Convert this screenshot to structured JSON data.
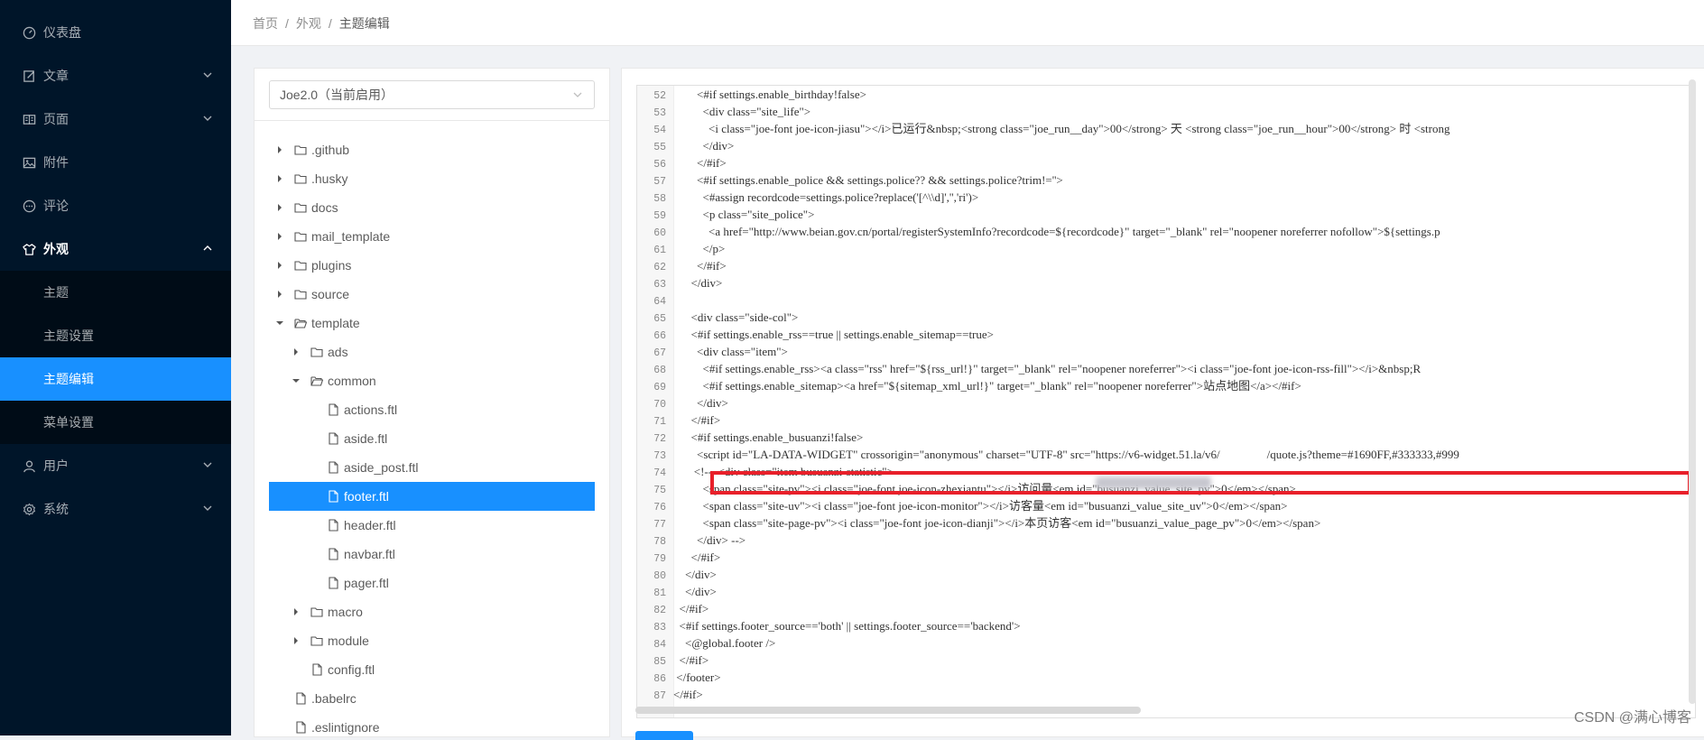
{
  "sidebar": {
    "items": [
      {
        "label": "仪表盘",
        "icon": "dashboard-icon"
      },
      {
        "label": "文章",
        "icon": "form-icon"
      },
      {
        "label": "页面",
        "icon": "read-icon"
      },
      {
        "label": "附件",
        "icon": "picture-icon"
      },
      {
        "label": "评论",
        "icon": "message-icon"
      },
      {
        "label": "外观",
        "icon": "skin-icon"
      },
      {
        "label": "用户",
        "icon": "user-icon"
      },
      {
        "label": "系统",
        "icon": "setting-icon"
      }
    ],
    "appearance_sub": [
      "主题",
      "主题设置",
      "主题编辑",
      "菜单设置"
    ]
  },
  "breadcrumb": [
    "首页",
    "外观",
    "主题编辑"
  ],
  "theme_select": {
    "value": "Joe2.0（当前启用）"
  },
  "file_tree": [
    {
      "name": ".github",
      "type": "folder"
    },
    {
      "name": ".husky",
      "type": "folder"
    },
    {
      "name": "docs",
      "type": "folder"
    },
    {
      "name": "mail_template",
      "type": "folder"
    },
    {
      "name": "plugins",
      "type": "folder"
    },
    {
      "name": "source",
      "type": "folder"
    },
    {
      "name": "template",
      "type": "folder-open"
    },
    {
      "name": "ads",
      "type": "folder"
    },
    {
      "name": "common",
      "type": "folder-open"
    },
    {
      "name": "actions.ftl",
      "type": "file"
    },
    {
      "name": "aside.ftl",
      "type": "file"
    },
    {
      "name": "aside_post.ftl",
      "type": "file"
    },
    {
      "name": "footer.ftl",
      "type": "file"
    },
    {
      "name": "header.ftl",
      "type": "file"
    },
    {
      "name": "navbar.ftl",
      "type": "file"
    },
    {
      "name": "pager.ftl",
      "type": "file"
    },
    {
      "name": "macro",
      "type": "folder"
    },
    {
      "name": "module",
      "type": "folder"
    },
    {
      "name": "config.ftl",
      "type": "file"
    },
    {
      "name": ".babelrc",
      "type": "file"
    },
    {
      "name": ".eslintignore",
      "type": "file"
    }
  ],
  "code_lines": [
    {
      "n": "52",
      "t": "        <#if settings.enable_birthday!false>"
    },
    {
      "n": "53",
      "t": "          <div class=\"site_life\">"
    },
    {
      "n": "54",
      "t": "            <i class=\"joe-font joe-icon-jiasu\"></i>已运行&nbsp;<strong class=\"joe_run__day\">00</strong> 天 <strong class=\"joe_run__hour\">00</strong> 时 <strong"
    },
    {
      "n": "55",
      "t": "          </div>"
    },
    {
      "n": "56",
      "t": "        </#if>"
    },
    {
      "n": "57",
      "t": "        <#if settings.enable_police && settings.police?? && settings.police?trim!=''>"
    },
    {
      "n": "58",
      "t": "          <#assign recordcode=settings.police?replace('[^\\\\d]','','ri')>"
    },
    {
      "n": "59",
      "t": "          <p class=\"site_police\">"
    },
    {
      "n": "60",
      "t": "            <a href=\"http://www.beian.gov.cn/portal/registerSystemInfo?recordcode=${recordcode}\" target=\"_blank\" rel=\"noopener noreferrer nofollow\">${settings.p"
    },
    {
      "n": "61",
      "t": "          </p>"
    },
    {
      "n": "62",
      "t": "        </#if>"
    },
    {
      "n": "63",
      "t": "      </div>"
    },
    {
      "n": "64",
      "t": ""
    },
    {
      "n": "65",
      "t": "      <div class=\"side-col\">"
    },
    {
      "n": "66",
      "t": "      <#if settings.enable_rss==true || settings.enable_sitemap==true>"
    },
    {
      "n": "67",
      "t": "        <div class=\"item\">"
    },
    {
      "n": "68",
      "t": "          <#if settings.enable_rss><a class=\"rss\" href=\"${rss_url!}\" target=\"_blank\" rel=\"noopener noreferrer\"><i class=\"joe-font joe-icon-rss-fill\"></i>&nbsp;R"
    },
    {
      "n": "69",
      "t": "          <#if settings.enable_sitemap><a href=\"${sitemap_xml_url!}\" target=\"_blank\" rel=\"noopener noreferrer\">站点地图</a></#if>"
    },
    {
      "n": "70",
      "t": "        </div>"
    },
    {
      "n": "71",
      "t": "      </#if>"
    },
    {
      "n": "72",
      "t": "      <#if settings.enable_busuanzi!false>"
    },
    {
      "n": "73",
      "t": "        <script id=\"LA-DATA-WIDGET\" crossorigin=\"anonymous\" charset=\"UTF-8\" src=\"https://v6-widget.51.la/v6/                /quote.js?theme=#1690FF,#333333,#999"
    },
    {
      "n": "74",
      "t": "       <!--  <div class=\"item busuanzi-statistic\">"
    },
    {
      "n": "75",
      "t": "          <span class=\"site-pv\"><i class=\"joe-font joe-icon-zhexiantu\"></i>访问量<em id=\"busuanzi_value_site_pv\">0</em></span>"
    },
    {
      "n": "76",
      "t": "          <span class=\"site-uv\"><i class=\"joe-font joe-icon-monitor\"></i>访客量<em id=\"busuanzi_value_site_uv\">0</em></span>"
    },
    {
      "n": "77",
      "t": "          <span class=\"site-page-pv\"><i class=\"joe-font joe-icon-dianji\"></i>本页访客<em id=\"busuanzi_value_page_pv\">0</em></span>"
    },
    {
      "n": "78",
      "t": "        </div> -->"
    },
    {
      "n": "79",
      "t": "      </#if>"
    },
    {
      "n": "80",
      "t": "    </div>"
    },
    {
      "n": "81",
      "t": "    </div>"
    },
    {
      "n": "82",
      "t": "  </#if>"
    },
    {
      "n": "83",
      "t": "  <#if settings.footer_source=='both' || settings.footer_source=='backend'>"
    },
    {
      "n": "84",
      "t": "    <@global.footer />"
    },
    {
      "n": "85",
      "t": "  </#if>"
    },
    {
      "n": "86",
      "t": " </footer>"
    },
    {
      "n": "87",
      "t": "</#if>"
    }
  ],
  "watermark": "CSDN @满心博客"
}
